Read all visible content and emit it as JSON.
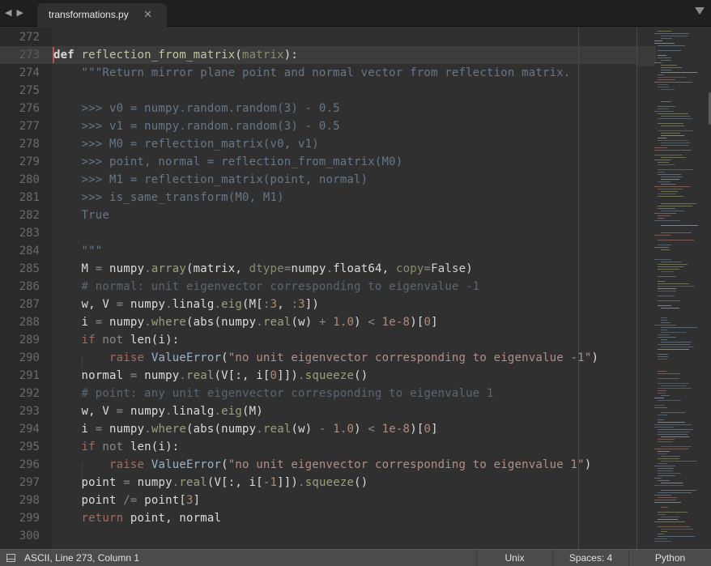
{
  "tabbar": {
    "back_icon": "◀",
    "forward_icon": "▶",
    "tab_title": "transformations.py",
    "close_icon": "✕"
  },
  "editor": {
    "current_line": 273,
    "lines": [
      {
        "n": "272",
        "tokens": []
      },
      {
        "n": "273",
        "tokens": [
          [
            "kw",
            "def"
          ],
          [
            "",
            "",
            ""
          ],
          [
            "fn",
            " reflection_from_matrix"
          ],
          [
            "",
            "("
          ],
          [
            "param",
            "matrix"
          ],
          [
            "",
            "):"
          ]
        ]
      },
      {
        "n": "274",
        "tokens": [
          [
            "doc",
            "    \"\"\"Return mirror plane point and normal vector from reflection matrix."
          ]
        ]
      },
      {
        "n": "275",
        "tokens": []
      },
      {
        "n": "276",
        "tokens": [
          [
            "doc",
            "    >>> v0 = numpy.random.random(3) - 0.5"
          ]
        ]
      },
      {
        "n": "277",
        "tokens": [
          [
            "doc",
            "    >>> v1 = numpy.random.random(3) - 0.5"
          ]
        ]
      },
      {
        "n": "278",
        "tokens": [
          [
            "doc",
            "    >>> M0 = reflection_matrix(v0, v1)"
          ]
        ]
      },
      {
        "n": "279",
        "tokens": [
          [
            "doc",
            "    >>> point, normal = reflection_from_matrix(M0)"
          ]
        ]
      },
      {
        "n": "280",
        "tokens": [
          [
            "doc",
            "    >>> M1 = reflection_matrix(point, normal)"
          ]
        ]
      },
      {
        "n": "281",
        "tokens": [
          [
            "doc",
            "    >>> is_same_transform(M0, M1)"
          ]
        ]
      },
      {
        "n": "282",
        "tokens": [
          [
            "doc",
            "    True"
          ]
        ]
      },
      {
        "n": "283",
        "tokens": []
      },
      {
        "n": "284",
        "tokens": [
          [
            "doc",
            "    \"\"\""
          ]
        ]
      },
      {
        "n": "285",
        "tokens": [
          [
            "",
            "    M "
          ],
          [
            "op",
            "="
          ],
          [
            "",
            " numpy"
          ],
          [
            "op",
            "."
          ],
          [
            "attr",
            "array"
          ],
          [
            "",
            "(matrix, "
          ],
          [
            "param",
            "dtype"
          ],
          [
            "op",
            "="
          ],
          [
            "",
            "numpy"
          ],
          [
            "op",
            "."
          ],
          [
            "",
            "float64, "
          ],
          [
            "param",
            "copy"
          ],
          [
            "op",
            "="
          ],
          [
            "bi",
            "False"
          ],
          [
            "",
            ")"
          ]
        ]
      },
      {
        "n": "286",
        "tokens": [
          [
            "cmt",
            "    # normal: unit eigenvector corresponding to eigenvalue -1"
          ]
        ]
      },
      {
        "n": "287",
        "tokens": [
          [
            "",
            "    w, V "
          ],
          [
            "op",
            "="
          ],
          [
            "",
            " numpy"
          ],
          [
            "op",
            "."
          ],
          [
            "",
            "linalg"
          ],
          [
            "op",
            "."
          ],
          [
            "attr",
            "eig"
          ],
          [
            "",
            "(M["
          ],
          [
            "op",
            ":"
          ],
          [
            "num",
            "3"
          ],
          [
            "",
            ", "
          ],
          [
            "op",
            ":"
          ],
          [
            "num",
            "3"
          ],
          [
            "",
            "])"
          ]
        ]
      },
      {
        "n": "288",
        "tokens": [
          [
            "",
            "    i "
          ],
          [
            "op",
            "="
          ],
          [
            "",
            " numpy"
          ],
          [
            "op",
            "."
          ],
          [
            "attr",
            "where"
          ],
          [
            "",
            "(abs(numpy"
          ],
          [
            "op",
            "."
          ],
          [
            "attr",
            "real"
          ],
          [
            "",
            "(w) "
          ],
          [
            "op",
            "+"
          ],
          [
            "num",
            " 1.0"
          ],
          [
            "",
            ") "
          ],
          [
            "op",
            "<"
          ],
          [
            "num",
            " 1e-8"
          ],
          [
            "",
            ")["
          ],
          [
            "num",
            "0"
          ],
          [
            "",
            "]"
          ]
        ]
      },
      {
        "n": "289",
        "tokens": [
          [
            "flow",
            "    if"
          ],
          [
            "op",
            " not"
          ],
          [
            "",
            " len(i):"
          ]
        ]
      },
      {
        "n": "290",
        "tokens": [
          [
            "flow",
            "        raise"
          ],
          [
            "cls",
            " ValueError"
          ],
          [
            "",
            "("
          ],
          [
            "str",
            "\"no unit eigenvector corresponding to eigenvalue -1\""
          ],
          [
            "",
            ")"
          ]
        ]
      },
      {
        "n": "291",
        "tokens": [
          [
            "",
            "    normal "
          ],
          [
            "op",
            "="
          ],
          [
            "",
            " numpy"
          ],
          [
            "op",
            "."
          ],
          [
            "attr",
            "real"
          ],
          [
            "",
            "(V[:, i["
          ],
          [
            "num",
            "0"
          ],
          [
            "",
            "]])"
          ],
          [
            "op",
            "."
          ],
          [
            "attr",
            "squeeze"
          ],
          [
            "",
            "()"
          ]
        ]
      },
      {
        "n": "292",
        "tokens": [
          [
            "cmt",
            "    # point: any unit eigenvector corresponding to eigenvalue 1"
          ]
        ]
      },
      {
        "n": "293",
        "tokens": [
          [
            "",
            "    w, V "
          ],
          [
            "op",
            "="
          ],
          [
            "",
            " numpy"
          ],
          [
            "op",
            "."
          ],
          [
            "",
            "linalg"
          ],
          [
            "op",
            "."
          ],
          [
            "attr",
            "eig"
          ],
          [
            "",
            "(M)"
          ]
        ]
      },
      {
        "n": "294",
        "tokens": [
          [
            "",
            "    i "
          ],
          [
            "op",
            "="
          ],
          [
            "",
            " numpy"
          ],
          [
            "op",
            "."
          ],
          [
            "attr",
            "where"
          ],
          [
            "",
            "(abs(numpy"
          ],
          [
            "op",
            "."
          ],
          [
            "attr",
            "real"
          ],
          [
            "",
            "(w) "
          ],
          [
            "op",
            "-"
          ],
          [
            "num",
            " 1.0"
          ],
          [
            "",
            ") "
          ],
          [
            "op",
            "<"
          ],
          [
            "num",
            " 1e-8"
          ],
          [
            "",
            ")["
          ],
          [
            "num",
            "0"
          ],
          [
            "",
            "]"
          ]
        ]
      },
      {
        "n": "295",
        "tokens": [
          [
            "flow",
            "    if"
          ],
          [
            "op",
            " not"
          ],
          [
            "",
            " len(i):"
          ]
        ]
      },
      {
        "n": "296",
        "tokens": [
          [
            "flow",
            "        raise"
          ],
          [
            "cls",
            " ValueError"
          ],
          [
            "",
            "("
          ],
          [
            "str",
            "\"no unit eigenvector corresponding to eigenvalue 1\""
          ],
          [
            "",
            ")"
          ]
        ]
      },
      {
        "n": "297",
        "tokens": [
          [
            "",
            "    point "
          ],
          [
            "op",
            "="
          ],
          [
            "",
            " numpy"
          ],
          [
            "op",
            "."
          ],
          [
            "attr",
            "real"
          ],
          [
            "",
            "(V[:, i["
          ],
          [
            "num",
            "-1"
          ],
          [
            "",
            "]])"
          ],
          [
            "op",
            "."
          ],
          [
            "attr",
            "squeeze"
          ],
          [
            "",
            "()"
          ]
        ]
      },
      {
        "n": "298",
        "tokens": [
          [
            "",
            "    point "
          ],
          [
            "op",
            "/="
          ],
          [
            "",
            " point["
          ],
          [
            "num",
            "3"
          ],
          [
            "",
            "]"
          ]
        ]
      },
      {
        "n": "299",
        "tokens": [
          [
            "flow",
            "    return"
          ],
          [
            "",
            " point, normal"
          ]
        ]
      },
      {
        "n": "300",
        "tokens": []
      }
    ]
  },
  "statusbar": {
    "position": "ASCII, Line 273, Column 1",
    "line_endings": "Unix",
    "indentation": "Spaces: 4",
    "syntax": "Python"
  }
}
